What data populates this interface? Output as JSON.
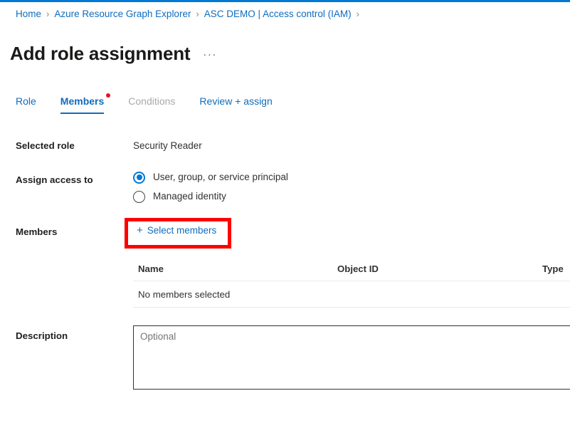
{
  "theme": {
    "accent_blue": "#0078d4",
    "link_blue": "#0f6cbd",
    "highlight_red": "#fd0000",
    "badge_red": "#e81123",
    "disabled_grey": "#a9a9a9"
  },
  "breadcrumb": {
    "items": [
      {
        "label": "Home"
      },
      {
        "label": "Azure Resource Graph Explorer"
      },
      {
        "label": "ASC DEMO | Access control (IAM)"
      }
    ],
    "separator": "›"
  },
  "header": {
    "title": "Add role assignment",
    "more_menu": "···"
  },
  "tabs": [
    {
      "label": "Role",
      "state": "enabled",
      "badge": false
    },
    {
      "label": "Members",
      "state": "active",
      "badge": true
    },
    {
      "label": "Conditions",
      "state": "disabled",
      "badge": false
    },
    {
      "label": "Review + assign",
      "state": "enabled",
      "badge": false
    }
  ],
  "form": {
    "selected_role": {
      "label": "Selected role",
      "value": "Security Reader"
    },
    "assign_access_to": {
      "label": "Assign access to",
      "options": [
        {
          "label": "User, group, or service principal",
          "selected": true
        },
        {
          "label": "Managed identity",
          "selected": false
        }
      ]
    },
    "members": {
      "label": "Members",
      "select_button": {
        "plus_icon": "+",
        "label": "Select members",
        "highlighted": true
      },
      "table": {
        "columns": [
          "Name",
          "Object ID",
          "Type"
        ],
        "empty_message": "No members selected",
        "rows": []
      }
    },
    "description": {
      "label": "Description",
      "value": "",
      "placeholder": "Optional"
    }
  }
}
